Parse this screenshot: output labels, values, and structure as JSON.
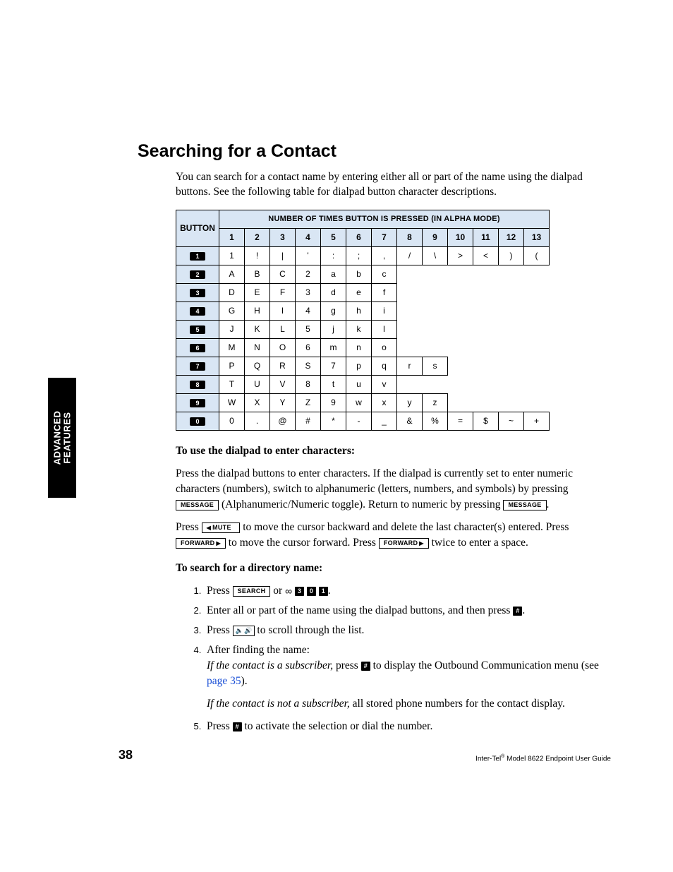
{
  "heading": "Searching for a Contact",
  "intro": "You can search for a contact name by entering either all or part of the name using the dialpad buttons. See the following table for dialpad button character descriptions.",
  "table": {
    "spanHeader": "NUMBER OF TIMES BUTTON IS PRESSED (IN ALPHA MODE)",
    "buttonHeader": "BUTTON",
    "cols": [
      "1",
      "2",
      "3",
      "4",
      "5",
      "6",
      "7",
      "8",
      "9",
      "10",
      "11",
      "12",
      "13"
    ],
    "rows": [
      {
        "key": "1",
        "cells": [
          "1",
          "!",
          "|",
          "'",
          ":",
          ";",
          ",",
          "/",
          "\\",
          ">",
          "<",
          ")",
          "("
        ]
      },
      {
        "key": "2",
        "cells": [
          "A",
          "B",
          "C",
          "2",
          "a",
          "b",
          "c",
          "",
          "",
          "",
          "",
          "",
          ""
        ]
      },
      {
        "key": "3",
        "cells": [
          "D",
          "E",
          "F",
          "3",
          "d",
          "e",
          "f",
          "",
          "",
          "",
          "",
          "",
          ""
        ]
      },
      {
        "key": "4",
        "cells": [
          "G",
          "H",
          "I",
          "4",
          "g",
          "h",
          "i",
          "",
          "",
          "",
          "",
          "",
          ""
        ]
      },
      {
        "key": "5",
        "cells": [
          "J",
          "K",
          "L",
          "5",
          "j",
          "k",
          "l",
          "",
          "",
          "",
          "",
          "",
          ""
        ]
      },
      {
        "key": "6",
        "cells": [
          "M",
          "N",
          "O",
          "6",
          "m",
          "n",
          "o",
          "",
          "",
          "",
          "",
          "",
          ""
        ]
      },
      {
        "key": "7",
        "cells": [
          "P",
          "Q",
          "R",
          "S",
          "7",
          "p",
          "q",
          "r",
          "s",
          "",
          "",
          "",
          ""
        ]
      },
      {
        "key": "8",
        "cells": [
          "T",
          "U",
          "V",
          "8",
          "t",
          "u",
          "v",
          "",
          "",
          "",
          "",
          "",
          ""
        ]
      },
      {
        "key": "9",
        "cells": [
          "W",
          "X",
          "Y",
          "Z",
          "9",
          "w",
          "x",
          "y",
          "z",
          "",
          "",
          "",
          ""
        ]
      },
      {
        "key": "0",
        "cells": [
          "0",
          ".",
          "@",
          "#",
          "*",
          "-",
          "_",
          "&",
          "%",
          "=",
          "$",
          "~",
          "+"
        ]
      }
    ]
  },
  "proc1": {
    "title": "To use the dialpad to enter characters:",
    "p1a": "Press the dialpad buttons to enter characters. If the dialpad is currently set to enter numeric characters (numbers), switch to alphanumeric (letters, numbers, and symbols) by pressing ",
    "msg": "MESSAGE",
    "p1b": " (Alphanumeric/Numeric toggle). Return to numeric by pressing ",
    "p1c": ".",
    "p2a": "Press ",
    "mute": "MUTE",
    "p2b": " to move the cursor backward and delete the last character(s) entered. Press ",
    "fwd": "FORWARD",
    "p2c": " to move the cursor forward. Press ",
    "p2d": " twice to enter a space."
  },
  "proc2": {
    "title": "To search for a directory name:",
    "s1a": "Press ",
    "search": "SEARCH",
    "s1b": " or ",
    "k3": "3",
    "k0": "0",
    "k1": "1",
    "s1c": ".",
    "s2a": "Enter all or part of the name using the dialpad buttons, and then press ",
    "hash": "#",
    "s2b": ".",
    "s3a": "Press ",
    "s3b": " to scroll through the list.",
    "s4": "After finding the name:",
    "s4a_i": "If the contact is a subscriber,",
    "s4a_1": " press ",
    "s4a_2": " to display the Outbound Communication menu (see ",
    "s4a_link": "page 35",
    "s4a_3": ").",
    "s4b_i": "If the contact is not a subscriber,",
    "s4b_1": " all stored phone numbers for the contact display.",
    "s5a": "Press ",
    "s5b": " to activate the selection or dial the number."
  },
  "sidetab": "ADVANCED\nFEATURES",
  "footer": {
    "page": "38",
    "guide_a": "Inter-Tel",
    "guide_b": " Model 8622 Endpoint User Guide"
  },
  "chart_data": {
    "type": "table",
    "title": "Dialpad button character mapping (alpha mode)",
    "columns": [
      "BUTTON",
      "1",
      "2",
      "3",
      "4",
      "5",
      "6",
      "7",
      "8",
      "9",
      "10",
      "11",
      "12",
      "13"
    ],
    "rows": [
      [
        "1",
        "1",
        "!",
        "|",
        "'",
        ":",
        ";",
        ",",
        "/",
        "\\",
        ">",
        "<",
        ")",
        "("
      ],
      [
        "2",
        "A",
        "B",
        "C",
        "2",
        "a",
        "b",
        "c",
        "",
        "",
        "",
        "",
        "",
        ""
      ],
      [
        "3",
        "D",
        "E",
        "F",
        "3",
        "d",
        "e",
        "f",
        "",
        "",
        "",
        "",
        "",
        ""
      ],
      [
        "4",
        "G",
        "H",
        "I",
        "4",
        "g",
        "h",
        "i",
        "",
        "",
        "",
        "",
        "",
        ""
      ],
      [
        "5",
        "J",
        "K",
        "L",
        "5",
        "j",
        "k",
        "l",
        "",
        "",
        "",
        "",
        "",
        ""
      ],
      [
        "6",
        "M",
        "N",
        "O",
        "6",
        "m",
        "n",
        "o",
        "",
        "",
        "",
        "",
        "",
        ""
      ],
      [
        "7",
        "P",
        "Q",
        "R",
        "S",
        "7",
        "p",
        "q",
        "r",
        "s",
        "",
        "",
        "",
        ""
      ],
      [
        "8",
        "T",
        "U",
        "V",
        "8",
        "t",
        "u",
        "v",
        "",
        "",
        "",
        "",
        "",
        ""
      ],
      [
        "9",
        "W",
        "X",
        "Y",
        "Z",
        "9",
        "w",
        "x",
        "y",
        "z",
        "",
        "",
        "",
        ""
      ],
      [
        "0",
        "0",
        ".",
        "@",
        "#",
        "*",
        "-",
        "_",
        "&",
        "%",
        "=",
        "$",
        "~",
        "+"
      ]
    ]
  }
}
